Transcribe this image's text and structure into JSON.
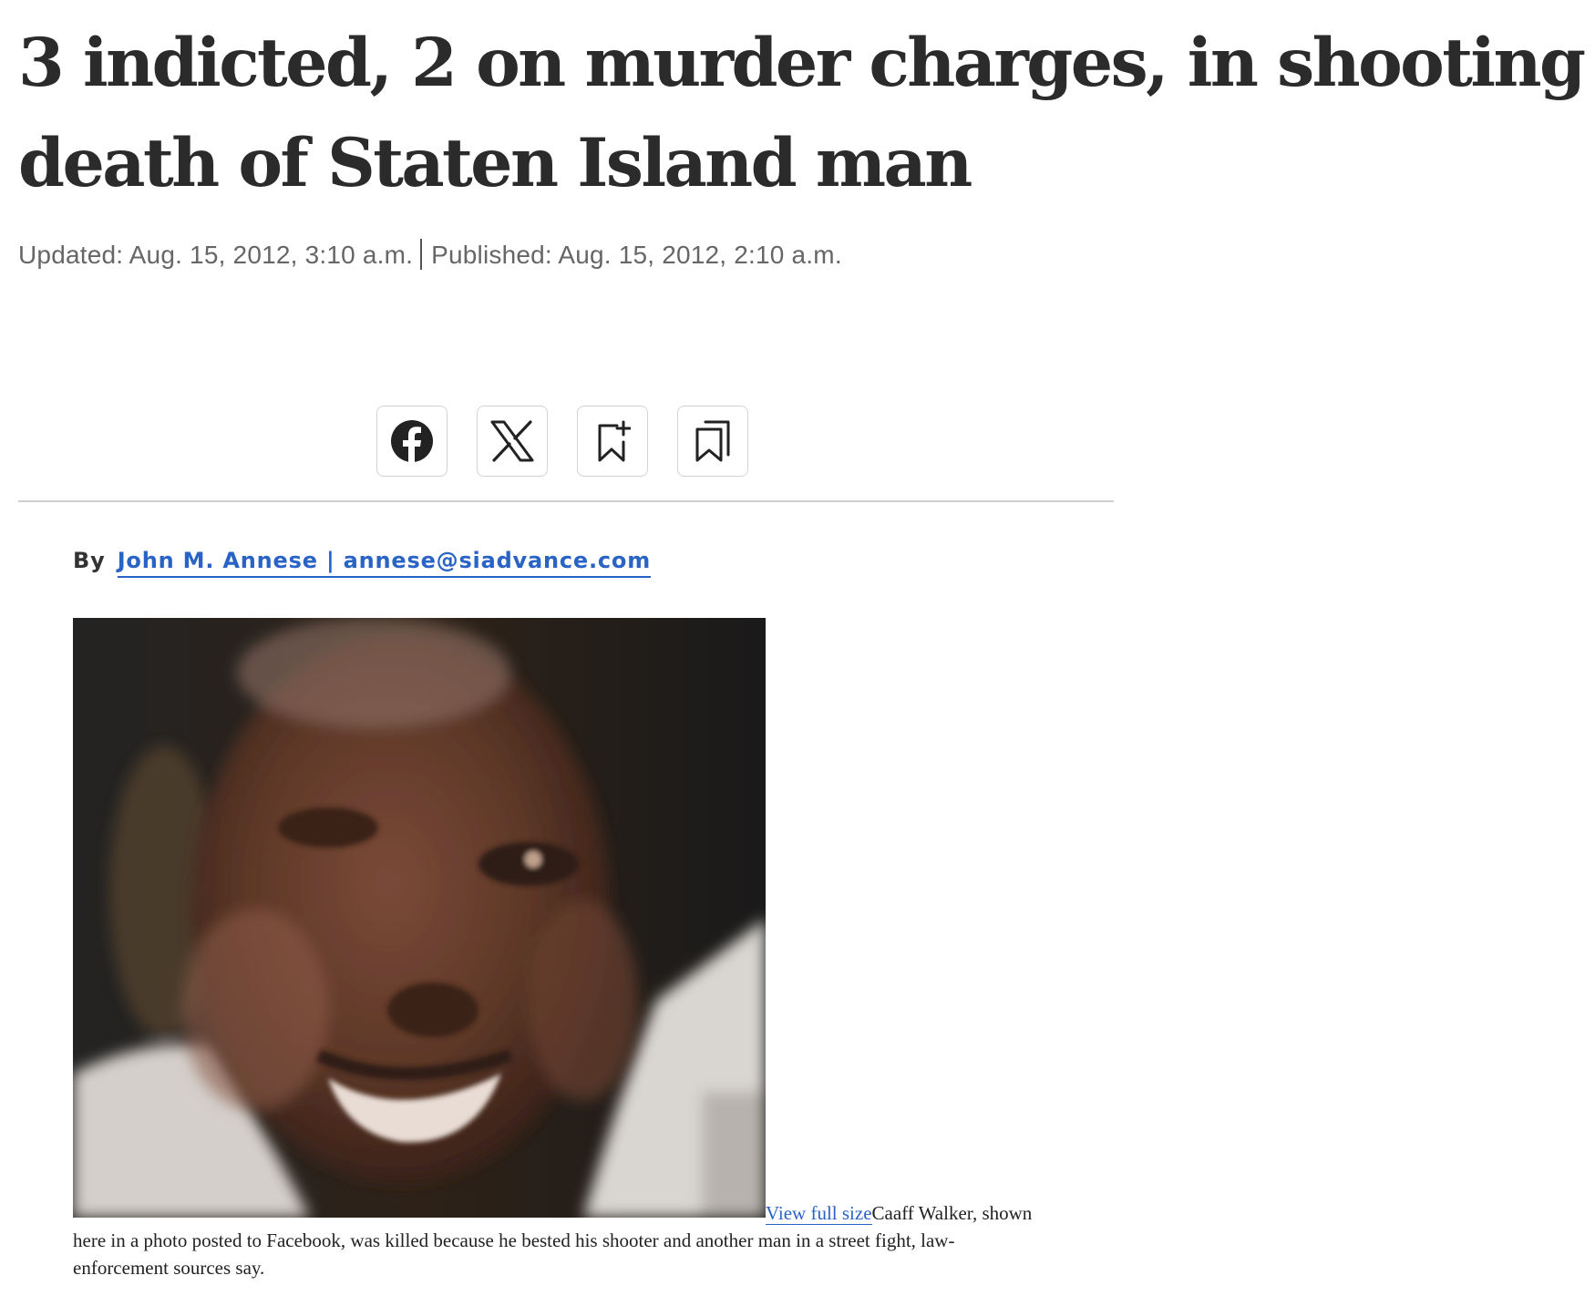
{
  "article": {
    "headline_line1": "3 indicted, 2 on murder charges, in shooting",
    "headline_line2": "death of Staten Island man",
    "updated": "Updated: Aug. 15, 2012, 3:10 a.m.",
    "published": "Published: Aug. 15, 2012, 2:10 a.m.",
    "byline_prefix": "By",
    "byline_link": "John M. Annese | annese@siadvance.com"
  },
  "share": {
    "icons": [
      "facebook-icon",
      "x-icon",
      "bookmark-add-icon",
      "bookmarks-icon"
    ]
  },
  "photo": {
    "view_full_size": "View full size",
    "caption": "Caaff Walker, shown here in a photo posted to Facebook, was killed because he bested his shooter and another man in a street fight, law-enforcement sources say."
  },
  "colors": {
    "link": "#2a63c6",
    "headline": "#2b2b2b",
    "meta": "#666666"
  }
}
